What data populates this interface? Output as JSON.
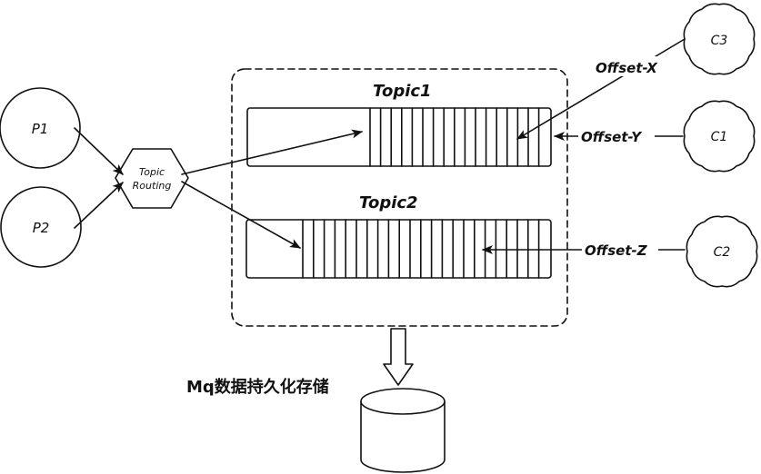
{
  "producers": [
    {
      "id": "p1",
      "label": "P1"
    },
    {
      "id": "p2",
      "label": "P2"
    }
  ],
  "router": {
    "line1": "Topic",
    "line2": "Routing"
  },
  "topics": [
    {
      "id": "topic1",
      "title": "Topic1"
    },
    {
      "id": "topic2",
      "title": "Topic2"
    }
  ],
  "consumers": [
    {
      "id": "c3",
      "label": "C3"
    },
    {
      "id": "c1",
      "label": "C1"
    },
    {
      "id": "c2",
      "label": "C2"
    }
  ],
  "offsets": {
    "x": "Offset-X",
    "y": "Offset-Y",
    "z": "Offset-Z"
  },
  "storage": {
    "label": "Mq数据持久化存储"
  },
  "colors": {
    "ink": "#111111",
    "background": "#ffffff"
  }
}
